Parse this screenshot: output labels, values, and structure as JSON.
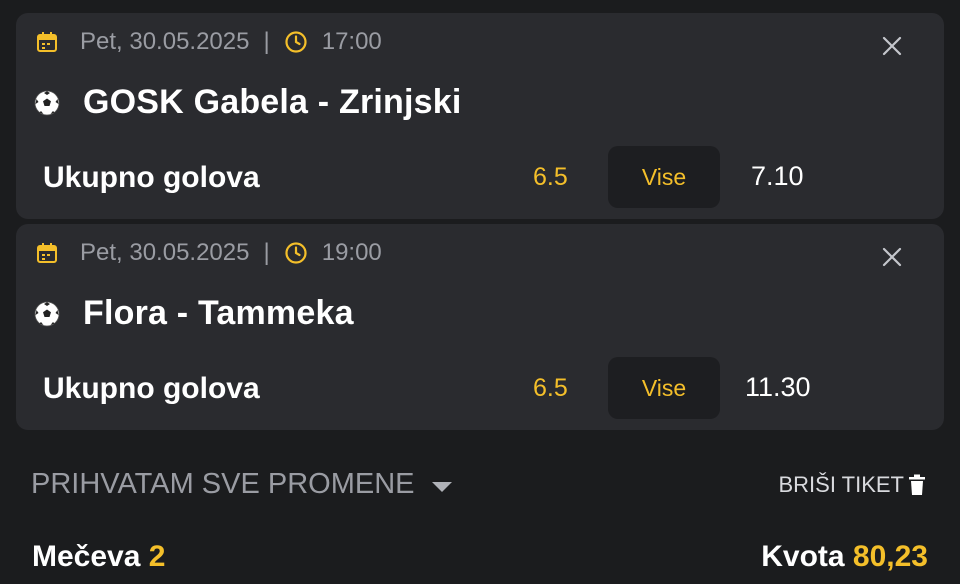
{
  "accent_color": "#f4bf2a",
  "matches": [
    {
      "date": "Pet, 30.05.2025",
      "separator": "|",
      "time": "17:00",
      "teams": "GOSK Gabela - Zrinjski",
      "market": "Ukupno golova",
      "line": "6.5",
      "pick": "Vise",
      "odd": "7.10",
      "icons": [
        "calendar-icon",
        "clock-icon",
        "soccer-ball-icon",
        "close-icon"
      ]
    },
    {
      "date": "Pet, 30.05.2025",
      "separator": "|",
      "time": "19:00",
      "teams": "Flora - Tammeka",
      "market": "Ukupno golova",
      "line": "6.5",
      "pick": "Vise",
      "odd": "11.30",
      "icons": [
        "calendar-icon",
        "clock-icon",
        "soccer-ball-icon",
        "close-icon"
      ]
    }
  ],
  "accept_changes": "PRIHVATAM SVE PROMENE",
  "delete_ticket": "BRIŠI TIKET",
  "summary": {
    "matches_label": "Mečeva",
    "matches_count": "2",
    "odds_label": "Kvota",
    "odds_value": "80,23"
  }
}
